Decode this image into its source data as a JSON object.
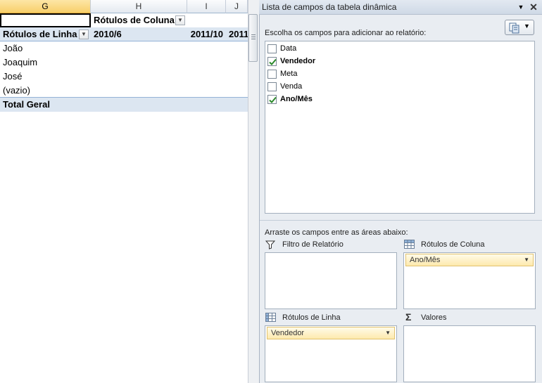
{
  "sheet": {
    "columns": [
      "G",
      "H",
      "I",
      "J"
    ],
    "column_filter_label": "Rótulos de Coluna",
    "row_filter_label": "Rótulos de Linha",
    "column_values": [
      "2010/6",
      "2011/10",
      "2011"
    ],
    "rows": [
      "João",
      "Joaquim",
      "José",
      "(vazio)"
    ],
    "total_label": "Total Geral"
  },
  "pane": {
    "title": "Lista de campos da tabela dinâmica",
    "choose_label": "Escolha os campos para adicionar ao relatório:",
    "fields": [
      {
        "label": "Data",
        "checked": false
      },
      {
        "label": "Vendedor",
        "checked": true
      },
      {
        "label": "Meta",
        "checked": false
      },
      {
        "label": "Venda",
        "checked": false
      },
      {
        "label": "Ano/Mês",
        "checked": true
      }
    ],
    "drag_label": "Arraste os campos entre as áreas abaixo:",
    "areas": {
      "report_filter": "Filtro de Relatório",
      "column_labels": "Rótulos de Coluna",
      "row_labels": "Rótulos de Linha",
      "values": "Valores"
    },
    "column_chip": "Ano/Mês",
    "row_chip": "Vendedor"
  },
  "colors": {
    "selected_column_header": "#f8cf6a",
    "row_band": "#dce6f1",
    "check_green": "#2c8a2c",
    "chip_fill": "#fde9ad"
  }
}
